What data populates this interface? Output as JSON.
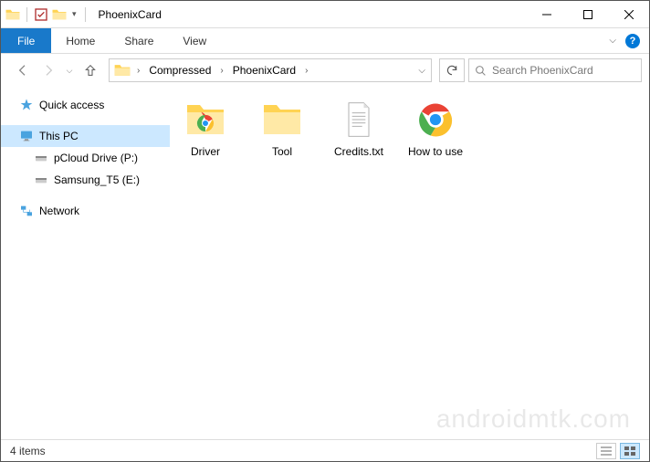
{
  "title": "PhoenixCard",
  "ribbon": {
    "file": "File",
    "tabs": [
      "Home",
      "Share",
      "View"
    ]
  },
  "breadcrumb": [
    "Compressed",
    "PhoenixCard"
  ],
  "search": {
    "placeholder": "Search PhoenixCard"
  },
  "sidebar": {
    "items": [
      {
        "label": "Quick access",
        "icon": "star"
      },
      {
        "label": "This PC",
        "icon": "pc"
      },
      {
        "label": "pCloud Drive (P:)",
        "icon": "drive"
      },
      {
        "label": "Samsung_T5 (E:)",
        "icon": "drive"
      },
      {
        "label": "Network",
        "icon": "network"
      }
    ]
  },
  "files": [
    {
      "label": "Driver",
      "type": "folder-chrome"
    },
    {
      "label": "Tool",
      "type": "folder"
    },
    {
      "label": "Credits.txt",
      "type": "txt"
    },
    {
      "label": "How to use",
      "type": "chrome"
    }
  ],
  "status": {
    "count": "4 items"
  },
  "watermark": "androidmtk.com"
}
